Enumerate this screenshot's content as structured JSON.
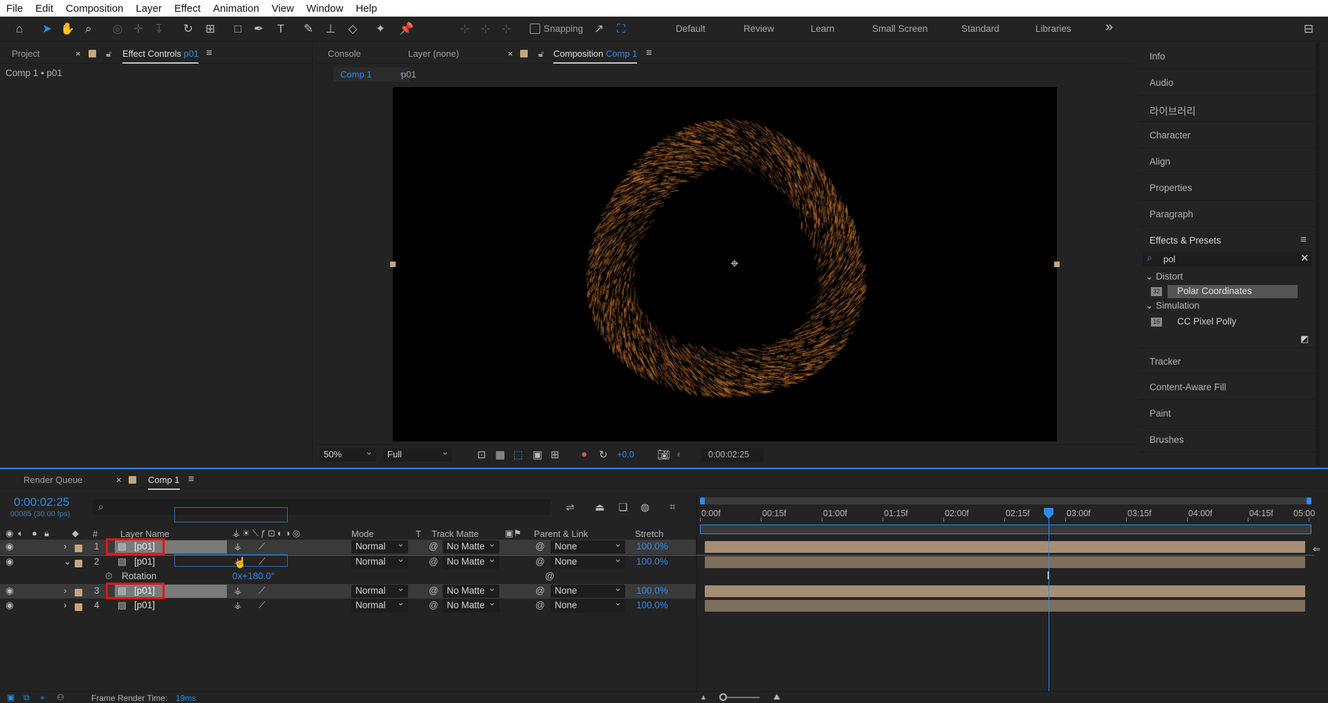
{
  "menu": [
    "File",
    "Edit",
    "Composition",
    "Layer",
    "Effect",
    "Animation",
    "View",
    "Window",
    "Help"
  ],
  "toolbar": {
    "snapping_label": "Snapping",
    "workspaces": [
      "Default",
      "Review",
      "Learn",
      "Small Screen",
      "Standard",
      "Libraries"
    ],
    "more": "»"
  },
  "left_panel": {
    "tab_project": "Project",
    "tab_effect_controls": "Effect Controls",
    "tab_effect_controls_target": "p01",
    "breadcrumb": "Comp 1 • p01"
  },
  "center_panel": {
    "tab_console": "Console",
    "tab_layer": "Layer (none)",
    "tab_composition": "Composition",
    "tab_composition_target": "Comp 1",
    "flow_comp": "Comp 1",
    "flow_layer": "p01",
    "zoom": "50%",
    "resolution": "Full",
    "exposure": "+0.0",
    "timecode": "0:00:02:25"
  },
  "right_panel": {
    "items_top": [
      "Info",
      "Audio",
      "라이브러리",
      "Character",
      "Align",
      "Properties",
      "Paragraph"
    ],
    "effects_presets_title": "Effects & Presets",
    "search_value": "pol",
    "groups": [
      {
        "name": "Distort",
        "item": "Polar Coordinates",
        "badge": "32"
      },
      {
        "name": "Simulation",
        "item": "CC Pixel Polly",
        "badge": "16"
      }
    ],
    "items_bottom": [
      "Tracker",
      "Content-Aware Fill",
      "Paint",
      "Brushes"
    ]
  },
  "timeline": {
    "tab_render_queue": "Render Queue",
    "tab_comp": "Comp 1",
    "timecode": "0:00:02:25",
    "frame_info": "00085 (30.00 fps)",
    "headers": {
      "num": "#",
      "layer_name": "Layer Name",
      "mode": "Mode",
      "t": "T",
      "track_matte": "Track Matte",
      "parent": "Parent & Link",
      "stretch": "Stretch"
    },
    "ruler": [
      "0:00f",
      "00:15f",
      "01:00f",
      "01:15f",
      "02:00f",
      "02:15f",
      "03:00f",
      "03:15f",
      "04:00f",
      "04:15f",
      "05:00"
    ],
    "playhead_fraction": 0.573,
    "layers": [
      {
        "num": "1",
        "name": "[p01]",
        "mode": "Normal",
        "matte": "No Matte",
        "parent": "None",
        "stretch": "100.0%"
      },
      {
        "num": "2",
        "name": "[p01]",
        "mode": "Normal",
        "matte": "No Matte",
        "parent": "None",
        "stretch": "100.0%"
      },
      {
        "num": "3",
        "name": "[p01]",
        "mode": "Normal",
        "matte": "No Matte",
        "parent": "None",
        "stretch": "100.0%"
      },
      {
        "num": "4",
        "name": "[p01]",
        "mode": "Normal",
        "matte": "No Matte",
        "parent": "None",
        "stretch": "100.0%"
      }
    ],
    "rotation_label": "Rotation",
    "rotation_value": "0x+180.0°",
    "status_label": "Frame Render Time:",
    "status_value": "19ms"
  },
  "colors": {
    "accent": "#2d8ceb",
    "label_tan": "#c4a580",
    "highlight_red": "#e11111",
    "particle_gold": "#d9a040"
  }
}
